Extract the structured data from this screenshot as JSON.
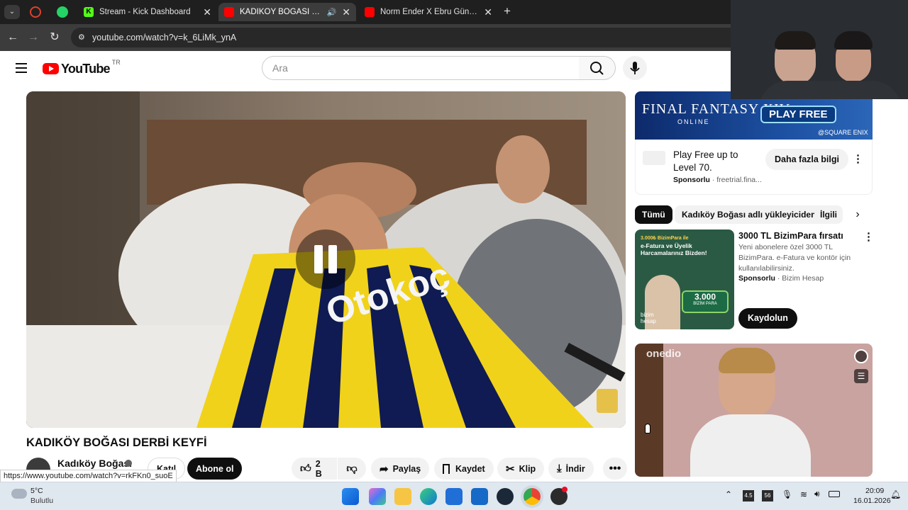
{
  "browser": {
    "tabs": [
      {
        "title": "Stream - Kick Dashboard",
        "active": false
      },
      {
        "title": "KADIKÖY BOĞASI DERBİ KE",
        "active": true
      },
      {
        "title": "Norm Ender X Ebru Gündeş - B",
        "active": false
      }
    ],
    "url": "youtube.com/watch?v=k_6LiMk_ynA",
    "status_url": "https://www.youtube.com/watch?v=rkFKn0_suoE"
  },
  "youtube": {
    "logo_text": "YouTube",
    "region": "TR",
    "search_placeholder": "Ara"
  },
  "video": {
    "title": "KADIKÖY BOĞASI DERBİ KEYFİ",
    "channel": "Kadıköy Boğası",
    "join_label": "Katıl",
    "subscribe_label": "Abone ol",
    "likes": "2 B",
    "share_label": "Paylaş",
    "save_label": "Kaydet",
    "clip_label": "Klip",
    "download_label": "İndir"
  },
  "ad_banner": {
    "brand": "FINAL FANTASY XIV",
    "brand_sub": "ONLINE",
    "cta_banner": "PLAY FREE",
    "credit": "@SQUARE ENIX",
    "headline": "Play Free up to Level 70.",
    "sponsored": "Sponsorlu",
    "domain": "freetrial.fina...",
    "cta": "Daha fazla bilgi"
  },
  "chips": [
    "Tümü",
    "Kadıköy Boğası adlı yükleyiciden",
    "İlgili"
  ],
  "promo": {
    "title": "3000 TL BizimPara fırsatı",
    "desc": "Yeni abonelere özel 3000 TL BizimPara. e-Fatura ve kontör için kullanılabilirsiniz.",
    "sponsored": "Sponsorlu",
    "advertiser": "Bizim Hesap",
    "cta": "Kaydolun",
    "thumb_line1": "3.000₺ BizimPara ile",
    "thumb_line2": "e-Fatura ve Üyelik Harcamalarınız Bizden!",
    "thumb_badge": "3.000",
    "thumb_badge_sub": "BİZİM PARA",
    "thumb_logo": "bizim hesap"
  },
  "next_video": {
    "overlay_brand": "onedio"
  },
  "taskbar": {
    "weather_temp": "5°C",
    "weather_desc": "Bulutlu",
    "time": "20:09",
    "date": "16.01.2026",
    "tray_badge1": "4.5",
    "tray_badge2": "56"
  },
  "colors": {
    "yt_red": "#ff0000",
    "chrome_dark": "#1f1f1f",
    "subscribe_bg": "#0f0f0f"
  }
}
